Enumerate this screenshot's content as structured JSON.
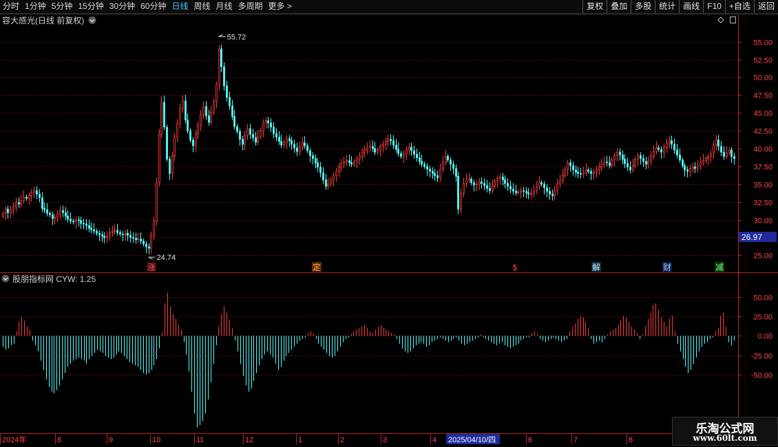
{
  "toolbar": {
    "periods": [
      {
        "label": "分时",
        "active": false
      },
      {
        "label": "1分钟",
        "active": false
      },
      {
        "label": "5分钟",
        "active": false
      },
      {
        "label": "15分钟",
        "active": false
      },
      {
        "label": "30分钟",
        "active": false
      },
      {
        "label": "60分钟",
        "active": false
      },
      {
        "label": "日线",
        "active": true
      },
      {
        "label": "周线",
        "active": false
      },
      {
        "label": "月线",
        "active": false
      },
      {
        "label": "多周期",
        "active": false
      },
      {
        "label": "更多 >",
        "active": false
      }
    ],
    "buttons": [
      "复权",
      "叠加",
      "多股",
      "统计",
      "画线",
      "F10",
      "+自选",
      "返回"
    ]
  },
  "main_title": "容大感光(日线 前复权)",
  "sub_title": "股朋指标网  CYW: 1.25",
  "price_marker": "26.97",
  "markers": [
    {
      "label": "涨",
      "bg": "#3a0a0a",
      "color": "#ff5a5a"
    },
    {
      "label": "定",
      "bg": "#5a2a00",
      "color": "#ffb050"
    },
    {
      "label": "$",
      "bg": "#000000",
      "color": "#ff4040"
    },
    {
      "label": "解",
      "bg": "#0a3040",
      "color": "#c0f0ff"
    },
    {
      "label": "财",
      "bg": "#10204a",
      "color": "#a0c8ff"
    },
    {
      "label": "减",
      "bg": "#0a3a0a",
      "color": "#70ff70"
    }
  ],
  "time_axis": [
    "2024年",
    "8",
    "9",
    "10",
    "11",
    "12",
    "1",
    "2",
    "3",
    "4",
    "2025/04/10/四",
    "6",
    "7",
    "8"
  ],
  "watermark": {
    "line1": "乐淘公式网",
    "line2": "www.60lt.com"
  },
  "colors": {
    "up": "#ff3c3c",
    "down": "#54ffff",
    "grid": "#8a1818",
    "axis": "#c02020",
    "text": "#d0d0d0"
  },
  "chart_data": [
    {
      "type": "candlestick",
      "title": "容大感光(日线 前复权)",
      "y_ticks": [
        25.0,
        27.5,
        30.0,
        32.5,
        35.0,
        37.5,
        40.0,
        42.5,
        45.0,
        47.5,
        50.0,
        52.5,
        55.0
      ],
      "ylim": [
        23.0,
        57.0
      ],
      "annotations": [
        {
          "label": "55.72",
          "value": 55.72
        },
        {
          "label": "24.74",
          "value": 24.74
        }
      ],
      "close": [
        30.9,
        31.5,
        31.0,
        31.4,
        31.8,
        32.4,
        32.2,
        32.7,
        33.2,
        33.0,
        33.4,
        33.8,
        34.1,
        33.6,
        33.1,
        31.6,
        31.4,
        30.9,
        30.7,
        30.2,
        30.4,
        30.8,
        31.3,
        31.0,
        30.5,
        30.1,
        29.8,
        29.7,
        30.0,
        29.9,
        29.5,
        29.4,
        29.2,
        28.8,
        28.6,
        28.4,
        28.1,
        27.9,
        27.7,
        27.5,
        27.7,
        28.2,
        28.4,
        28.5,
        28.2,
        28.0,
        27.9,
        28.1,
        27.8,
        27.5,
        27.4,
        27.2,
        27.3,
        27.0,
        26.6,
        26.2,
        26.0,
        27.8,
        29.8,
        35.2,
        42.0,
        46.5,
        43.0,
        38.5,
        36.5,
        39.0,
        41.6,
        43.5,
        45.6,
        46.7,
        44.0,
        42.5,
        41.2,
        40.4,
        42.1,
        43.2,
        44.8,
        45.9,
        44.6,
        43.7,
        45.1,
        46.6,
        49.0,
        54.0,
        51.5,
        48.8,
        47.2,
        46.0,
        44.5,
        43.1,
        42.4,
        41.3,
        40.6,
        41.9,
        42.8,
        42.0,
        41.5,
        40.9,
        41.7,
        42.5,
        43.7,
        43.9,
        43.6,
        43.0,
        42.1,
        41.6,
        41.0,
        40.5,
        40.9,
        41.4,
        41.1,
        40.6,
        40.1,
        39.6,
        40.2,
        40.8,
        40.4,
        39.7,
        39.0,
        38.6,
        38.0,
        37.4,
        36.6,
        35.6,
        34.7,
        35.0,
        35.6,
        36.2,
        36.8,
        37.4,
        37.9,
        38.1,
        38.3,
        38.0,
        37.8,
        38.2,
        38.6,
        39.0,
        39.5,
        39.8,
        40.1,
        40.3,
        40.0,
        39.5,
        39.8,
        40.3,
        40.6,
        41.0,
        41.3,
        41.1,
        40.5,
        39.9,
        39.3,
        38.9,
        39.3,
        39.8,
        40.2,
        39.7,
        39.2,
        38.7,
        38.2,
        37.8,
        37.5,
        37.1,
        36.8,
        36.5,
        36.2,
        35.9,
        37.1,
        38.1,
        38.9,
        38.4,
        37.8,
        37.2,
        36.1,
        31.5,
        33.7,
        35.1,
        35.6,
        35.7,
        35.2,
        34.9,
        35.0,
        35.3,
        35.1,
        34.8,
        34.4,
        34.1,
        34.7,
        35.4,
        35.8,
        36.0,
        35.6,
        35.1,
        34.7,
        34.3,
        34.0,
        33.8,
        33.9,
        34.1,
        34.0,
        33.8,
        33.6,
        33.7,
        34.1,
        34.6,
        35.2,
        35.0,
        34.5,
        34.0,
        33.6,
        33.4,
        34.1,
        35.0,
        35.5,
        36.2,
        37.1,
        38.0,
        37.6,
        37.0,
        36.7,
        36.5,
        36.4,
        36.6,
        37.0,
        36.8,
        36.5,
        36.7,
        37.0,
        37.4,
        37.8,
        38.1,
        38.0,
        37.6,
        38.4,
        39.0,
        39.5,
        39.1,
        38.5,
        37.9,
        37.4,
        37.0,
        37.6,
        38.5,
        39.0,
        38.6,
        38.2,
        37.8,
        38.2,
        38.9,
        39.6,
        40.1,
        39.9,
        39.5,
        40.2,
        40.8,
        41.1,
        40.6,
        39.8,
        39.1,
        38.4,
        37.6,
        37.0,
        36.8,
        37.2,
        37.4,
        37.2,
        37.6,
        38.0,
        38.3,
        38.6,
        38.9,
        39.3,
        40.5,
        41.2,
        40.3,
        39.5,
        38.9,
        39.4,
        39.8,
        38.9,
        38.6
      ]
    },
    {
      "type": "bar",
      "title": "CYW",
      "y_ticks": [
        50.0,
        25.0,
        0.0,
        -25.0,
        -50.0
      ],
      "ylim": [
        -122.0,
        66.0
      ],
      "values": [
        -14,
        -18,
        -16,
        -12,
        -10,
        6,
        18,
        24,
        20,
        12,
        8,
        -6,
        -12,
        -20,
        -32,
        -44,
        -56,
        -66,
        -72,
        -74,
        -70,
        -64,
        -56,
        -48,
        -40,
        -36,
        -32,
        -30,
        -28,
        -30,
        -32,
        -36,
        -30,
        -26,
        -22,
        -18,
        -20,
        -22,
        -26,
        -28,
        -30,
        -28,
        -24,
        -20,
        -22,
        -26,
        -30,
        -34,
        -36,
        -38,
        -40,
        -44,
        -48,
        -50,
        -48,
        -44,
        -38,
        -30,
        -16,
        4,
        42,
        56,
        38,
        28,
        22,
        14,
        8,
        -8,
        -24,
        -46,
        -72,
        -100,
        -118,
        -115,
        -110,
        -100,
        -82,
        -60,
        -36,
        -12,
        12,
        28,
        38,
        30,
        20,
        10,
        -6,
        -20,
        -36,
        -52,
        -64,
        -72,
        -68,
        -58,
        -48,
        -38,
        -30,
        -24,
        -20,
        -24,
        -28,
        -36,
        -44,
        -40,
        -32,
        -26,
        -22,
        -18,
        -14,
        -10,
        -6,
        -4,
        -2,
        4,
        6,
        3,
        -4,
        -10,
        -14,
        -18,
        -22,
        -26,
        -28,
        -26,
        -20,
        -14,
        -8,
        -4,
        -2,
        3,
        6,
        8,
        10,
        12,
        14,
        10,
        6,
        4,
        8,
        12,
        14,
        10,
        8,
        6,
        4,
        2,
        -4,
        -10,
        -16,
        -20,
        -22,
        -20,
        -16,
        -12,
        -10,
        -8,
        -10,
        -14,
        -12,
        -8,
        -6,
        -4,
        -2,
        -4,
        -6,
        -8,
        -6,
        -4,
        -2,
        -6,
        -10,
        -12,
        -10,
        -8,
        -6,
        -4,
        -2,
        2,
        -2,
        -4,
        -6,
        -8,
        -10,
        -12,
        -10,
        -8,
        -12,
        -14,
        -16,
        -14,
        -12,
        -10,
        -6,
        -4,
        -2,
        -2,
        4,
        6,
        2,
        -4,
        -6,
        -8,
        -6,
        -4,
        -2,
        -4,
        -6,
        -8,
        -6,
        -4,
        6,
        12,
        16,
        22,
        26,
        24,
        18,
        10,
        -4,
        -10,
        -8,
        -6,
        -8,
        -4,
        2,
        6,
        8,
        10,
        14,
        20,
        26,
        24,
        18,
        12,
        8,
        4,
        -4,
        2,
        12,
        22,
        30,
        40,
        42,
        34,
        24,
        18,
        12,
        22,
        26,
        6,
        -10,
        -20,
        -30,
        -40,
        -48,
        -44,
        -36,
        -28,
        -20,
        -14,
        -10,
        -8,
        -4,
        -2,
        6,
        10,
        26,
        30,
        12,
        -8,
        -12,
        -6
      ]
    }
  ]
}
